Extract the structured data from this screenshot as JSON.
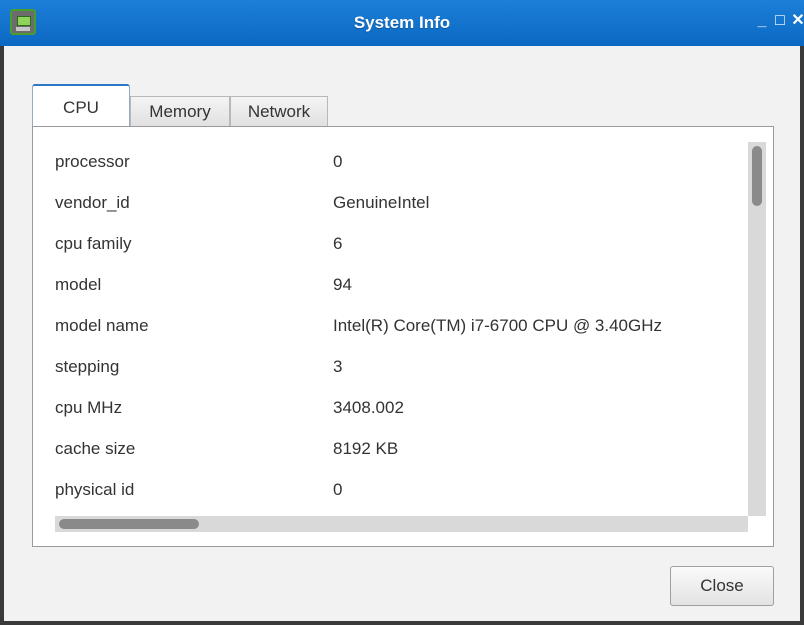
{
  "window": {
    "title": "System Info",
    "controls": {
      "minimize": "_",
      "maximize": "□",
      "close": "✕"
    },
    "icon": "system-monitor-icon"
  },
  "tabs": [
    {
      "label": "CPU",
      "active": true
    },
    {
      "label": "Memory",
      "active": false
    },
    {
      "label": "Network",
      "active": false
    }
  ],
  "cpu_info": [
    {
      "key": "processor",
      "value": "0"
    },
    {
      "key": "vendor_id",
      "value": "GenuineIntel"
    },
    {
      "key": "cpu family",
      "value": "6"
    },
    {
      "key": "model",
      "value": "94"
    },
    {
      "key": "model name",
      "value": "Intel(R) Core(TM) i7-6700 CPU @ 3.40GHz"
    },
    {
      "key": "stepping",
      "value": "3"
    },
    {
      "key": "cpu MHz",
      "value": "3408.002"
    },
    {
      "key": "cache size",
      "value": "8192 KB"
    },
    {
      "key": "physical id",
      "value": "0"
    }
  ],
  "footer": {
    "close_label": "Close"
  },
  "colors": {
    "titlebar": "#0b68c3",
    "active_tab_accent": "#2c78c8"
  }
}
